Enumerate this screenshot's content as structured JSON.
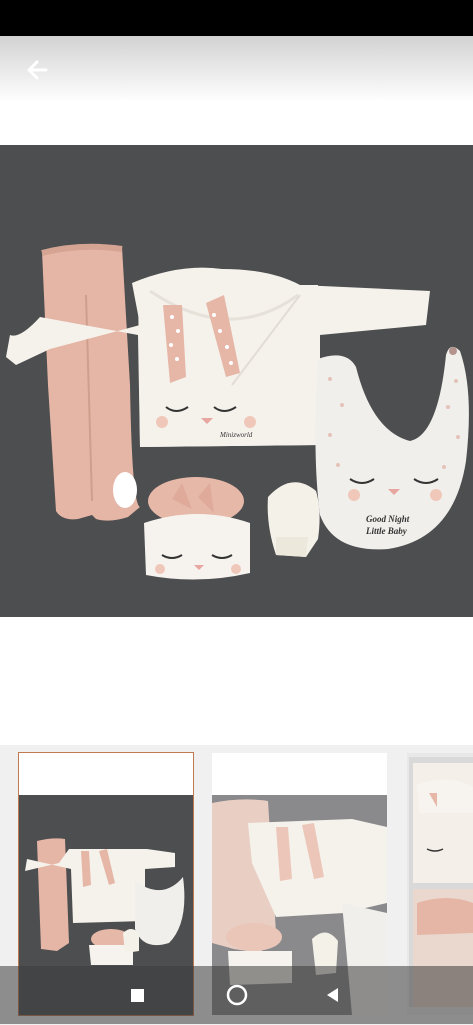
{
  "header": {
    "back_icon": "arrow-left-icon"
  },
  "product": {
    "bib_text_line1": "Good Night",
    "bib_text_line2": "Little Baby",
    "shirt_label": "Minizworld"
  },
  "colors": {
    "background_dark": "#4d4e50",
    "garment_white": "#f4f1ec",
    "garment_pink": "#e7b9a8",
    "selected_border": "#c07a4f"
  },
  "gallery": {
    "thumbnails": [
      "product-photo-1",
      "product-photo-2",
      "product-photo-3"
    ],
    "selected_index": 0
  },
  "navbar": {
    "recents_icon": "square-icon",
    "home_icon": "circle-icon",
    "back_icon": "triangle-back-icon"
  }
}
